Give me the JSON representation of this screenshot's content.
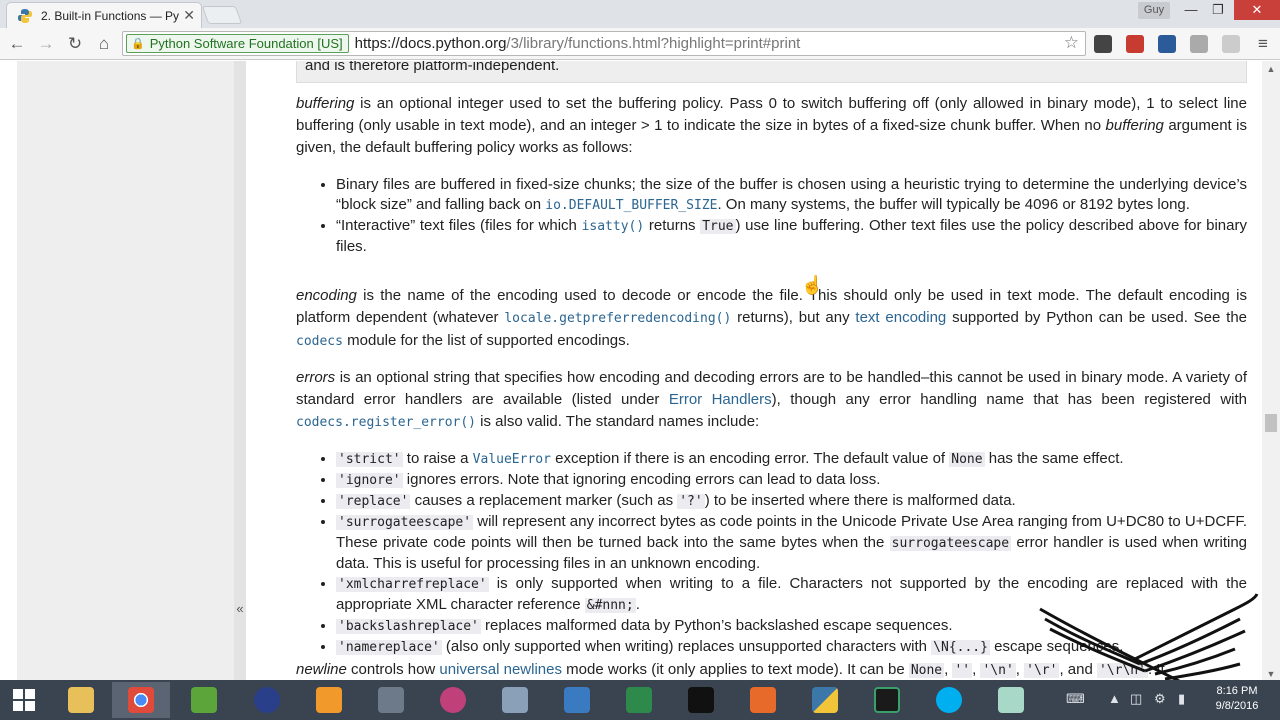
{
  "browser": {
    "tab_title": "2. Built-in Functions — Py",
    "user_name": "Guy",
    "ev_label": "Python Software Foundation [US]",
    "url_scheme_host": "https://docs.python.org",
    "url_path": "/3/library/functions.html?highlight=print#print"
  },
  "doc": {
    "top_fragment": "and is therefore platform-independent.",
    "buffering": {
      "term": "buffering",
      "text1": " is an optional integer used to set the buffering policy. Pass 0 to switch buffering off (only allowed in binary mode), 1 to select line buffering (only usable in text mode), and an integer > 1 to indicate the size in bytes of a fixed-size chunk buffer. When no ",
      "term2": "buffering",
      "text2": " argument is given, the default buffering policy works as follows:",
      "bullet1_a": "Binary files are buffered in fixed-size chunks; the size of the buffer is chosen using a heuristic trying to determine the underlying device’s “block size” and falling back on ",
      "bullet1_code": "io.DEFAULT_BUFFER_SIZE",
      "bullet1_b": ". On many systems, the buffer will typically be 4096 or 8192 bytes long.",
      "bullet2_a": "“Interactive” text files (files for which ",
      "bullet2_code1": "isatty()",
      "bullet2_b": " returns ",
      "bullet2_code2": "True",
      "bullet2_c": ") use line buffering. Other text files use the policy described above for binary files."
    },
    "encoding": {
      "term": "encoding",
      "text1": " is the name of the encoding used to decode or encode the file. This should only be used in text mode. The default encoding is platform dependent (whatever ",
      "code1": "locale.getpreferredencoding()",
      "text2": " returns), but any ",
      "link": "text encoding",
      "text3": " supported by Python can be used. See the ",
      "code2": "codecs",
      "text4": " module for the list of supported encodings."
    },
    "errors": {
      "term": "errors",
      "text1": " is an optional string that specifies how encoding and decoding errors are to be handled–this cannot be used in binary mode. A variety of standard error handlers are available (listed under ",
      "link": "Error Handlers",
      "text2": "), though any error handling name that has been registered with ",
      "code1": "codecs.register_error()",
      "text3": " is also valid. The standard names include:",
      "items": [
        {
          "code": "'strict'",
          "a": " to raise a ",
          "code2": "ValueError",
          "b": " exception if there is an encoding error. The default value of ",
          "code3": "None",
          "c": " has the same effect."
        },
        {
          "code": "'ignore'",
          "a": " ignores errors. Note that ignoring encoding errors can lead to data loss."
        },
        {
          "code": "'replace'",
          "a": " causes a replacement marker (such as ",
          "code2": "'?'",
          "b": ") to be inserted where there is malformed data."
        },
        {
          "code": "'surrogateescape'",
          "a": " will represent any incorrect bytes as code points in the Unicode Private Use Area ranging from U+DC80 to U+DCFF. These private code points will then be turned back into the same bytes when the ",
          "code2": "surrogateescape",
          "b": " error handler is used when writing data. This is useful for processing files in an unknown encoding."
        },
        {
          "code": "'xmlcharrefreplace'",
          "a": " is only supported when writing to a file. Characters not supported by the encoding are replaced with the appropriate XML character reference ",
          "code2": "&#nnn;",
          "b": "."
        },
        {
          "code": "'backslashreplace'",
          "a": " replaces malformed data by Python’s backslashed escape sequences."
        },
        {
          "code": "'namereplace'",
          "a": " (also only supported when writing) replaces unsupported characters with ",
          "code2": "\\N{...}",
          "b": " escape sequences."
        }
      ]
    },
    "newline": {
      "term": "newline",
      "text1": " controls how ",
      "link": "universal newlines",
      "text2": " mode works (it only applies to text mode). It can be ",
      "c1": "None",
      "c2": "''",
      "c3": "'\\n'",
      "c4": "'\\r'",
      "and": ", and ",
      "c5": "'\\r\\n'",
      "tail": ". It"
    }
  },
  "taskbar": {
    "time": "8:16 PM",
    "date": "9/8/2016"
  },
  "colors": {
    "link": "#2b6591",
    "sidebar_bg": "#eeeeee",
    "taskbar_bg": "#3a4350",
    "close_red": "#c9403a"
  }
}
